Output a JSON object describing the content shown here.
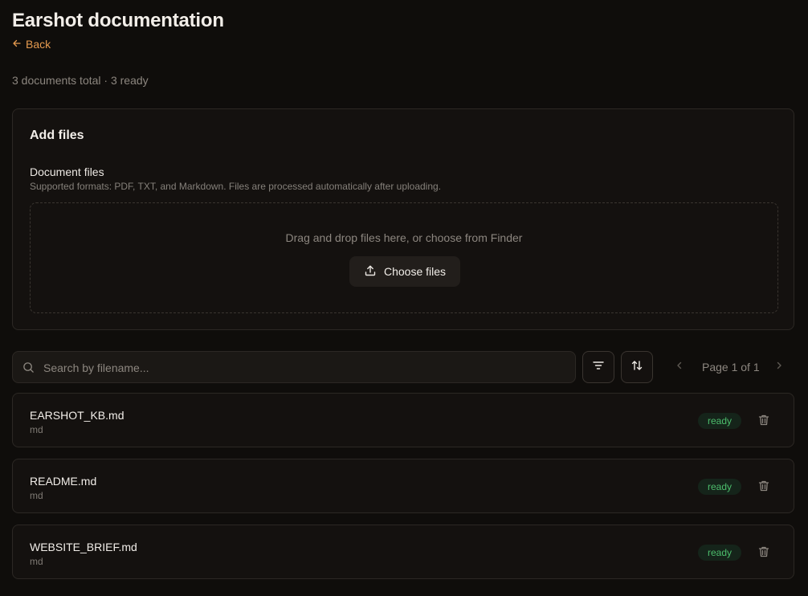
{
  "header": {
    "title": "Earshot documentation",
    "back_label": "Back",
    "summary": "3 documents total · 3 ready"
  },
  "upload": {
    "title": "Add files",
    "field_label": "Document files",
    "field_help": "Supported formats: PDF, TXT, and Markdown. Files are processed automatically after uploading.",
    "drop_text": "Drag and drop files here, or choose from Finder",
    "choose_label": "Choose files"
  },
  "toolbar": {
    "search_placeholder": "Search by filename...",
    "search_value": "",
    "page_label": "Page 1 of 1"
  },
  "files": [
    {
      "name": "EARSHOT_KB.md",
      "type": "md",
      "status": "ready"
    },
    {
      "name": "README.md",
      "type": "md",
      "status": "ready"
    },
    {
      "name": "WEBSITE_BRIEF.md",
      "type": "md",
      "status": "ready"
    }
  ],
  "icons": {
    "back": "arrow-left-icon",
    "upload": "upload-icon",
    "search": "search-icon",
    "filter": "filter-icon",
    "sort": "sort-icon",
    "prev": "chevron-left-icon",
    "next": "chevron-right-icon",
    "delete": "trash-icon"
  },
  "colors": {
    "background": "#0f0d0b",
    "accent": "#e59a4f",
    "ready_text": "#4cbd6c",
    "ready_bg": "#15241a"
  }
}
